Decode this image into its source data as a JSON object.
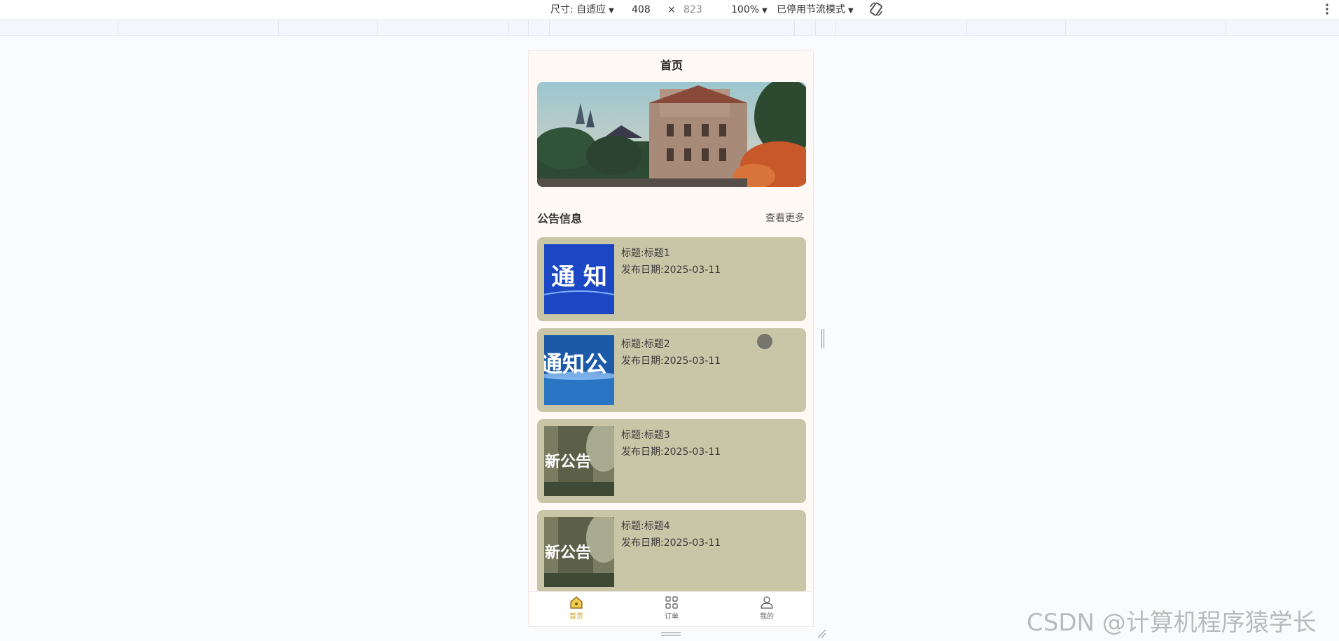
{
  "devtools": {
    "size_label": "尺寸: 自适应",
    "width": "408",
    "times": "×",
    "height": "823",
    "zoom": "100%",
    "throttle": "已停用节流模式"
  },
  "page": {
    "title": "首页",
    "banner_alt": "campus banner",
    "section_title": "公告信息",
    "more_link": "查看更多"
  },
  "notices": [
    {
      "title": "标题:标题1",
      "date": "发布日期:2025-03-11",
      "thumb_text": "通 知",
      "thumb_style": "blue"
    },
    {
      "title": "标题:标题2",
      "date": "发布日期:2025-03-11",
      "thumb_text": "通知公",
      "thumb_style": "blue-light"
    },
    {
      "title": "标题:标题3",
      "date": "发布日期:2025-03-11",
      "thumb_text": "新公告",
      "thumb_style": "sepia"
    },
    {
      "title": "标题:标题4",
      "date": "发布日期:2025-03-11",
      "thumb_text": "新公告",
      "thumb_style": "sepia"
    }
  ],
  "tabbar": {
    "home": "首页",
    "orders": "订单",
    "mine": "我的"
  },
  "watermark": "CSDN @计算机程序猿学长",
  "colors": {
    "card_bg": "#c9c6a8",
    "active_tab": "#c9a227",
    "page_bg": "#fff9f6"
  }
}
